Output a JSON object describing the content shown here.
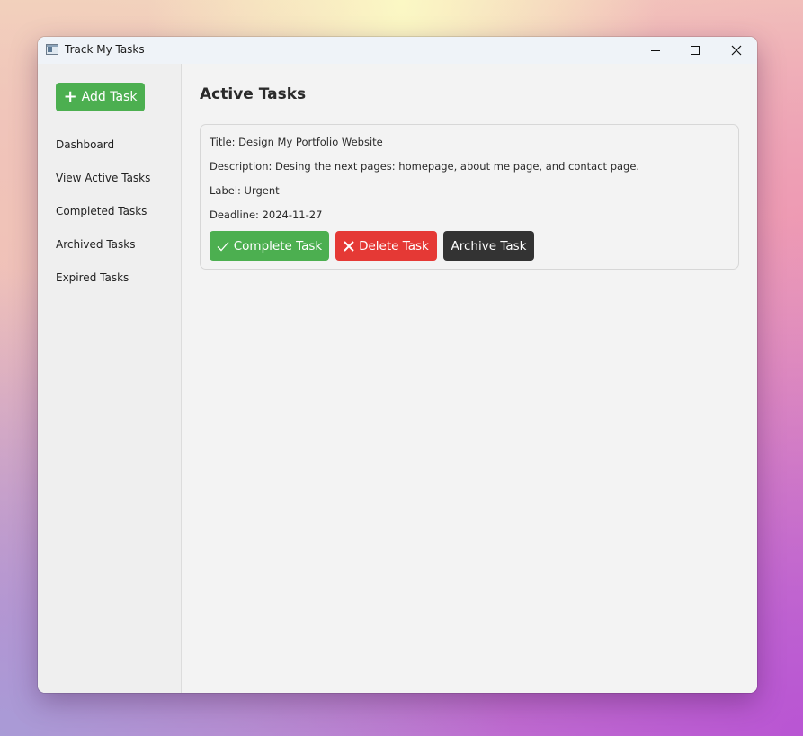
{
  "window": {
    "title": "Track My Tasks",
    "controls": {
      "minimize": "minimize-icon",
      "maximize": "maximize-icon",
      "close": "close-icon"
    }
  },
  "sidebar": {
    "add_task_label": "Add Task",
    "items": [
      {
        "label": "Dashboard"
      },
      {
        "label": "View Active Tasks"
      },
      {
        "label": "Completed Tasks"
      },
      {
        "label": "Archived Tasks"
      },
      {
        "label": "Expired Tasks"
      }
    ]
  },
  "main": {
    "title": "Active Tasks",
    "tasks": [
      {
        "title": "Title: Design My Portfolio Website",
        "description": "Description: Desing the next pages: homepage, about me page, and contact page.",
        "label": "Label: Urgent",
        "deadline": "Deadline: 2024-11-27",
        "complete_label": "Complete Task",
        "delete_label": "Delete Task",
        "archive_label": "Archive Task"
      }
    ]
  },
  "colors": {
    "success": "#4caf50",
    "danger": "#e53935",
    "dark": "#333333"
  }
}
